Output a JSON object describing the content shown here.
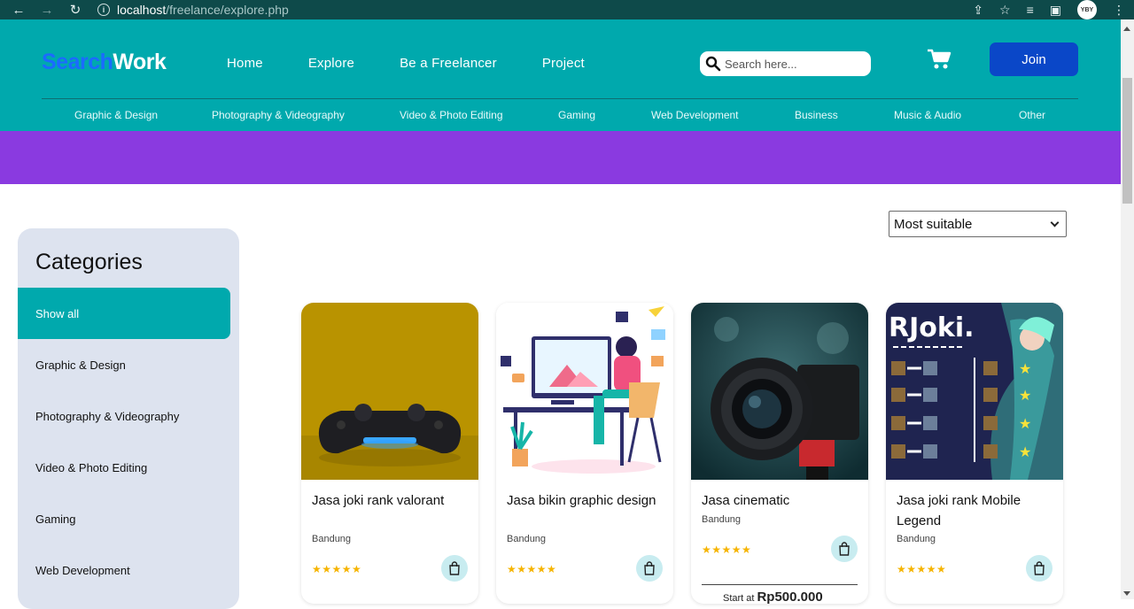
{
  "browser": {
    "url_host": "localhost",
    "url_path": "/freelance/explore.php",
    "avatar_text": "YBY"
  },
  "header": {
    "logo_part1": "Search",
    "logo_part2": "Work",
    "nav": [
      "Home",
      "Explore",
      "Be a Freelancer",
      "Project"
    ],
    "search_placeholder": "Search here...",
    "join_label": "Join",
    "accent": "#00a9ad",
    "join_color": "#0a47c8"
  },
  "subnav": [
    "Graphic & Design",
    "Photography & Videography",
    "Video & Photo Editing",
    "Gaming",
    "Web Development",
    "Business",
    "Music & Audio",
    "Other"
  ],
  "banner_color": "#8a3ae0",
  "sort": {
    "selected": "Most suitable"
  },
  "sidebar": {
    "title": "Categories",
    "items": [
      "Show all",
      "Graphic & Design",
      "Photography & Videography",
      "Video & Photo Editing",
      "Gaming",
      "Web Development"
    ]
  },
  "cards": [
    {
      "title": "Jasa joki rank valorant",
      "location": "Bandung",
      "stars": "★★★★★",
      "image": "game-controller"
    },
    {
      "title": "Jasa bikin graphic design",
      "location": "Bandung",
      "stars": "★★★★★",
      "image": "designer-illustration"
    },
    {
      "title": "Jasa cinematic",
      "location": "Bandung",
      "stars": "★★★★★",
      "image": "camera",
      "price_prefix": "Start at",
      "price": "Rp500.000"
    },
    {
      "title": "Jasa joki rank Mobile Legend",
      "location": "Bandung",
      "stars": "★★★★★",
      "image": "rjoki-poster",
      "image_text": "RJoki."
    }
  ]
}
